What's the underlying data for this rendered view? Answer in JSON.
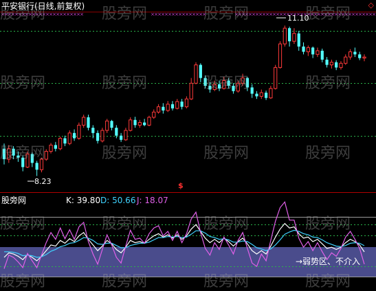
{
  "upper_panel": {
    "title": "平安银行(日线,前复权)",
    "high_label": "11.10",
    "low_label": "8.23",
    "signal_marker": "$",
    "corner_icon": "diamond-icon"
  },
  "lower_panel": {
    "title": "股旁网",
    "k_text": "K: 39.80",
    "d_text": "D: 50.66",
    "j_text": "J: 18.07",
    "annotation": "→弱势区、不介入"
  },
  "watermark": {
    "text": "股旁网"
  },
  "colors": {
    "background": "#000000",
    "up_candle": "#ff3a3a",
    "down_candle": "#54ffff",
    "k_line": "#ffffff",
    "d_line": "#3fd3ff",
    "j_line": "#e060e8",
    "weak_zone": "#4a4c8c",
    "dotted_level": "#2bb34a",
    "top_markers": "#d040d0"
  },
  "chart_data": [
    {
      "type": "candlestick",
      "title": "平安银行(日线,前复权)",
      "ylim": [
        8.0,
        11.3
      ],
      "low_point": 8.23,
      "high_point": 11.1,
      "candles": [
        {
          "o": 8.75,
          "c": 8.55,
          "h": 8.85,
          "l": 8.45
        },
        {
          "o": 8.55,
          "c": 8.75,
          "h": 8.82,
          "l": 8.48
        },
        {
          "o": 8.75,
          "c": 8.62,
          "h": 8.8,
          "l": 8.55
        },
        {
          "o": 8.62,
          "c": 8.58,
          "h": 8.7,
          "l": 8.5
        },
        {
          "o": 8.58,
          "c": 8.4,
          "h": 8.62,
          "l": 8.32
        },
        {
          "o": 8.4,
          "c": 8.65,
          "h": 8.7,
          "l": 8.38
        },
        {
          "o": 8.65,
          "c": 8.48,
          "h": 8.68,
          "l": 8.4
        },
        {
          "o": 8.48,
          "c": 8.35,
          "h": 8.52,
          "l": 8.23
        },
        {
          "o": 8.35,
          "c": 8.55,
          "h": 8.58,
          "l": 8.3
        },
        {
          "o": 8.55,
          "c": 8.7,
          "h": 8.74,
          "l": 8.52
        },
        {
          "o": 8.7,
          "c": 8.82,
          "h": 8.86,
          "l": 8.66
        },
        {
          "o": 8.82,
          "c": 8.75,
          "h": 8.88,
          "l": 8.7
        },
        {
          "o": 8.75,
          "c": 8.95,
          "h": 8.98,
          "l": 8.72
        },
        {
          "o": 8.95,
          "c": 8.85,
          "h": 9.0,
          "l": 8.8
        },
        {
          "o": 8.85,
          "c": 9.05,
          "h": 9.1,
          "l": 8.82
        },
        {
          "o": 9.05,
          "c": 8.95,
          "h": 9.12,
          "l": 8.9
        },
        {
          "o": 8.95,
          "c": 9.2,
          "h": 9.25,
          "l": 8.92
        },
        {
          "o": 9.2,
          "c": 9.35,
          "h": 9.4,
          "l": 9.15
        },
        {
          "o": 9.35,
          "c": 9.15,
          "h": 9.4,
          "l": 9.1
        },
        {
          "o": 9.15,
          "c": 9.05,
          "h": 9.2,
          "l": 8.95
        },
        {
          "o": 9.05,
          "c": 8.9,
          "h": 9.1,
          "l": 8.85
        },
        {
          "o": 8.9,
          "c": 9.1,
          "h": 9.15,
          "l": 8.87
        },
        {
          "o": 9.1,
          "c": 9.28,
          "h": 9.32,
          "l": 9.05
        },
        {
          "o": 9.28,
          "c": 9.15,
          "h": 9.3,
          "l": 9.1
        },
        {
          "o": 9.15,
          "c": 9.0,
          "h": 9.2,
          "l": 8.95
        },
        {
          "o": 9.0,
          "c": 8.92,
          "h": 9.05,
          "l": 8.88
        },
        {
          "o": 8.92,
          "c": 9.1,
          "h": 9.15,
          "l": 8.9
        },
        {
          "o": 9.1,
          "c": 9.3,
          "h": 9.35,
          "l": 9.08
        },
        {
          "o": 9.3,
          "c": 9.2,
          "h": 9.36,
          "l": 9.15
        },
        {
          "o": 9.2,
          "c": 9.25,
          "h": 9.3,
          "l": 9.15
        },
        {
          "o": 9.25,
          "c": 9.2,
          "h": 9.32,
          "l": 9.18
        },
        {
          "o": 9.2,
          "c": 9.35,
          "h": 9.38,
          "l": 9.18
        },
        {
          "o": 9.35,
          "c": 9.45,
          "h": 9.5,
          "l": 9.32
        },
        {
          "o": 9.45,
          "c": 9.55,
          "h": 9.6,
          "l": 9.42
        },
        {
          "o": 9.55,
          "c": 9.48,
          "h": 9.62,
          "l": 9.42
        },
        {
          "o": 9.48,
          "c": 9.6,
          "h": 9.66,
          "l": 9.45
        },
        {
          "o": 9.6,
          "c": 9.52,
          "h": 9.66,
          "l": 9.48
        },
        {
          "o": 9.52,
          "c": 9.65,
          "h": 9.7,
          "l": 9.5
        },
        {
          "o": 9.65,
          "c": 9.55,
          "h": 9.7,
          "l": 9.5
        },
        {
          "o": 9.55,
          "c": 9.7,
          "h": 9.75,
          "l": 9.52
        },
        {
          "o": 9.7,
          "c": 10.0,
          "h": 10.1,
          "l": 9.68
        },
        {
          "o": 10.0,
          "c": 10.35,
          "h": 10.4,
          "l": 9.98
        },
        {
          "o": 10.35,
          "c": 10.1,
          "h": 10.38,
          "l": 10.02
        },
        {
          "o": 10.1,
          "c": 9.95,
          "h": 10.15,
          "l": 9.9
        },
        {
          "o": 9.95,
          "c": 9.88,
          "h": 10.02,
          "l": 9.82
        },
        {
          "o": 9.88,
          "c": 9.98,
          "h": 10.05,
          "l": 9.85
        },
        {
          "o": 9.98,
          "c": 9.9,
          "h": 10.05,
          "l": 9.85
        },
        {
          "o": 9.9,
          "c": 10.05,
          "h": 10.12,
          "l": 9.88
        },
        {
          "o": 10.05,
          "c": 9.95,
          "h": 10.1,
          "l": 9.9
        },
        {
          "o": 9.95,
          "c": 9.85,
          "h": 10.0,
          "l": 9.8
        },
        {
          "o": 9.85,
          "c": 10.0,
          "h": 10.05,
          "l": 9.82
        },
        {
          "o": 10.0,
          "c": 10.1,
          "h": 10.18,
          "l": 9.95
        },
        {
          "o": 10.1,
          "c": 9.92,
          "h": 10.12,
          "l": 9.85
        },
        {
          "o": 9.92,
          "c": 9.8,
          "h": 9.98,
          "l": 9.72
        },
        {
          "o": 9.8,
          "c": 9.75,
          "h": 9.85,
          "l": 9.7
        },
        {
          "o": 9.75,
          "c": 9.82,
          "h": 9.88,
          "l": 9.7
        },
        {
          "o": 9.82,
          "c": 9.72,
          "h": 9.86,
          "l": 9.68
        },
        {
          "o": 9.72,
          "c": 9.9,
          "h": 9.95,
          "l": 9.7
        },
        {
          "o": 9.9,
          "c": 10.3,
          "h": 10.35,
          "l": 9.88
        },
        {
          "o": 10.3,
          "c": 10.75,
          "h": 10.8,
          "l": 10.28
        },
        {
          "o": 10.75,
          "c": 11.05,
          "h": 11.1,
          "l": 10.7
        },
        {
          "o": 11.05,
          "c": 10.8,
          "h": 11.08,
          "l": 10.7
        },
        {
          "o": 10.8,
          "c": 10.95,
          "h": 11.05,
          "l": 10.75
        },
        {
          "o": 10.95,
          "c": 10.7,
          "h": 11.0,
          "l": 10.62
        },
        {
          "o": 10.7,
          "c": 10.6,
          "h": 10.78,
          "l": 10.55
        },
        {
          "o": 10.6,
          "c": 10.68,
          "h": 10.72,
          "l": 10.52
        },
        {
          "o": 10.68,
          "c": 10.55,
          "h": 10.7,
          "l": 10.48
        },
        {
          "o": 10.55,
          "c": 10.62,
          "h": 10.68,
          "l": 10.5
        },
        {
          "o": 10.62,
          "c": 10.45,
          "h": 10.66,
          "l": 10.4
        },
        {
          "o": 10.45,
          "c": 10.35,
          "h": 10.5,
          "l": 10.3
        },
        {
          "o": 10.35,
          "c": 10.4,
          "h": 10.45,
          "l": 10.28
        },
        {
          "o": 10.4,
          "c": 10.3,
          "h": 10.44,
          "l": 10.25
        },
        {
          "o": 10.3,
          "c": 10.38,
          "h": 10.42,
          "l": 10.26
        },
        {
          "o": 10.38,
          "c": 10.5,
          "h": 10.55,
          "l": 10.35
        },
        {
          "o": 10.5,
          "c": 10.6,
          "h": 10.65,
          "l": 10.45
        },
        {
          "o": 10.6,
          "c": 10.55,
          "h": 10.68,
          "l": 10.5
        },
        {
          "o": 10.55,
          "c": 10.48,
          "h": 10.6,
          "l": 10.44
        },
        {
          "o": 10.48,
          "c": 10.5,
          "h": 10.55,
          "l": 10.42
        }
      ]
    },
    {
      "type": "line",
      "title": "股旁网",
      "ylim": [
        -10,
        115
      ],
      "series": [
        {
          "name": "K",
          "values": [
            30,
            38,
            36,
            32,
            26,
            35,
            30,
            24,
            32,
            42,
            52,
            50,
            60,
            55,
            63,
            58,
            68,
            74,
            62,
            52,
            42,
            50,
            60,
            54,
            44,
            38,
            48,
            60,
            56,
            58,
            55,
            62,
            68,
            72,
            66,
            70,
            64,
            70,
            62,
            68,
            80,
            88,
            76,
            64,
            56,
            62,
            56,
            64,
            58,
            50,
            58,
            64,
            54,
            42,
            36,
            42,
            36,
            50,
            66,
            80,
            90,
            82,
            84,
            72,
            64,
            66,
            58,
            62,
            54,
            46,
            48,
            44,
            48,
            56,
            62,
            58,
            52,
            39.8
          ]
        },
        {
          "name": "D",
          "values": [
            40,
            40,
            39,
            37,
            33,
            34,
            33,
            30,
            31,
            35,
            41,
            44,
            49,
            51,
            55,
            56,
            60,
            65,
            64,
            60,
            54,
            53,
            55,
            55,
            51,
            47,
            47,
            51,
            53,
            55,
            55,
            57,
            61,
            65,
            65,
            67,
            66,
            67,
            65,
            66,
            71,
            77,
            77,
            73,
            67,
            65,
            62,
            63,
            61,
            57,
            57,
            59,
            58,
            53,
            47,
            45,
            42,
            45,
            52,
            61,
            71,
            75,
            78,
            76,
            72,
            70,
            66,
            65,
            61,
            56,
            53,
            50,
            49,
            51,
            55,
            56,
            55,
            50.66
          ]
        },
        {
          "name": "J",
          "values": [
            10,
            34,
            30,
            22,
            12,
            37,
            24,
            12,
            34,
            56,
            74,
            62,
            82,
            63,
            79,
            62,
            84,
            92,
            58,
            36,
            18,
            44,
            70,
            52,
            30,
            20,
            50,
            78,
            62,
            64,
            55,
            72,
            82,
            86,
            68,
            76,
            60,
            76,
            56,
            72,
            98,
            110,
            74,
            46,
            34,
            56,
            44,
            66,
            52,
            36,
            60,
            74,
            46,
            20,
            14,
            36,
            24,
            60,
            94,
            118,
            128,
            96,
            96,
            64,
            48,
            58,
            42,
            56,
            40,
            26,
            38,
            32,
            46,
            66,
            76,
            62,
            46,
            18.07
          ]
        }
      ]
    }
  ]
}
